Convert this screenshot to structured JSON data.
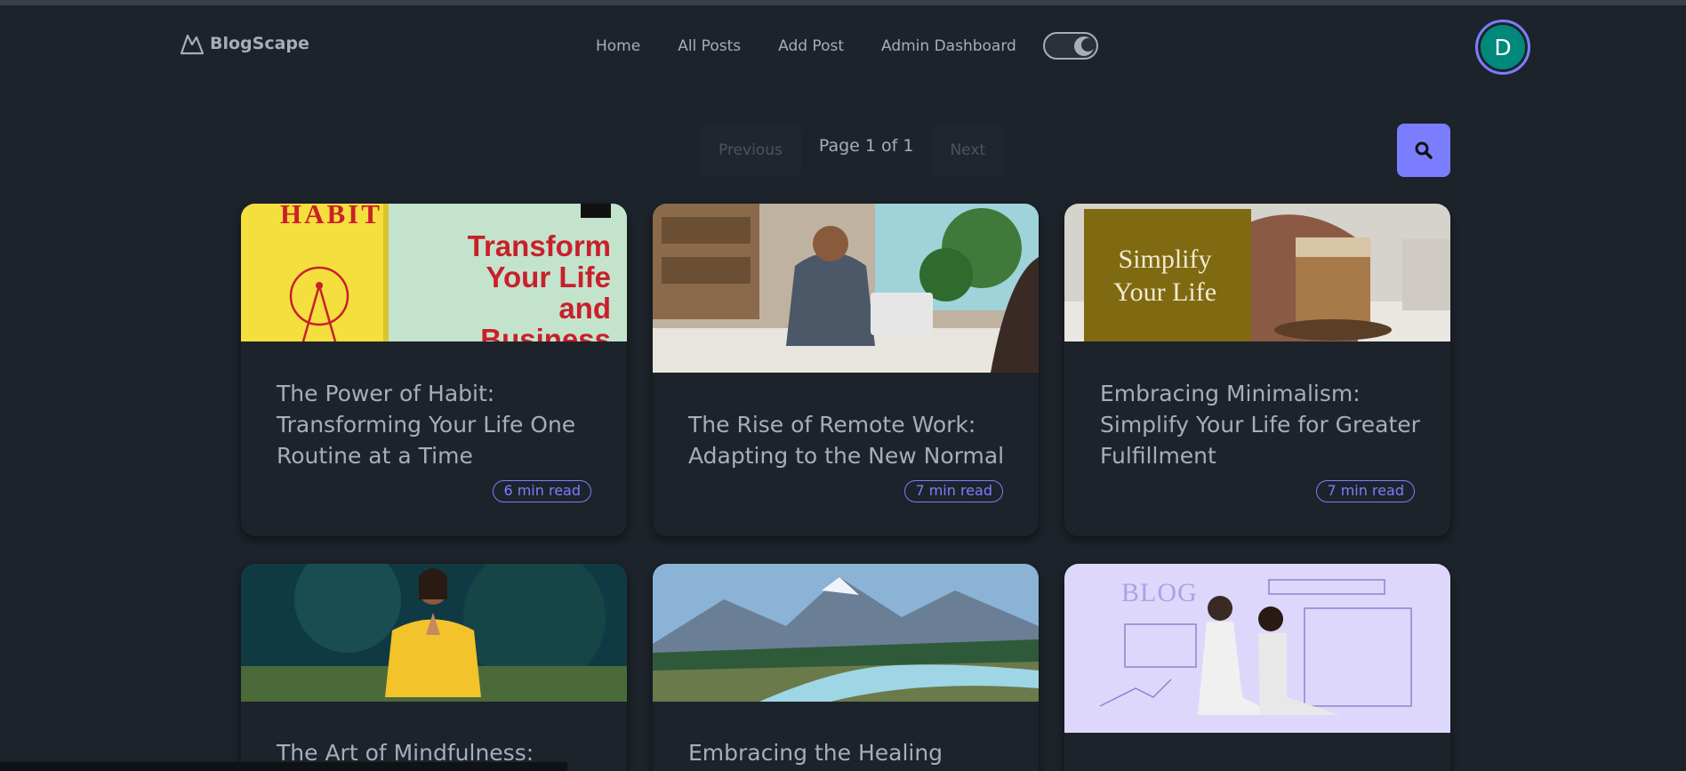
{
  "brand": {
    "name": "BlogScape",
    "logo_icon": "mountain-logo-icon"
  },
  "nav": {
    "links": [
      "Home",
      "All Posts",
      "Add Post",
      "Admin Dashboard"
    ],
    "theme_toggle_icon": "moon-icon",
    "avatar_initial": "D"
  },
  "pagination": {
    "previous": "Previous",
    "label": "Page 1 of 1",
    "next": "Next"
  },
  "search": {
    "icon": "search-icon"
  },
  "posts": [
    {
      "title": "The Power of Habit: Transforming Your Life One Routine at a Time",
      "read_time": "6 min read",
      "image_text": {
        "book": "HABIT",
        "headline": "Transform Your Life and Business"
      }
    },
    {
      "title": "The Rise of Remote Work: Adapting to the New Normal",
      "read_time": "7 min read"
    },
    {
      "title": "Embracing Minimalism: Simplify Your Life for Greater Fulfillment",
      "read_time": "7 min read",
      "image_text": {
        "sign": "Simplify Your Life"
      }
    },
    {
      "title": "The Art of Mindfulness:"
    },
    {
      "title": "Embracing the Healing Power"
    },
    {
      "title": "",
      "image_text": {
        "sign": "BLOG"
      }
    }
  ],
  "colors": {
    "background": "#1d232a",
    "accent": "#7b7dff",
    "text": "#a6adbb",
    "avatar": "#00897b"
  }
}
